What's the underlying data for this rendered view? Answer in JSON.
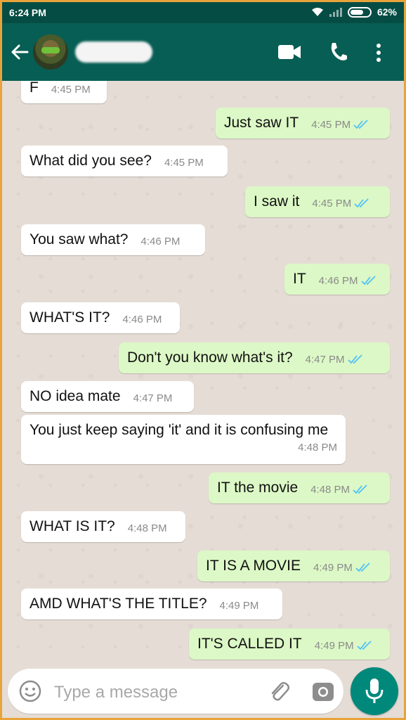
{
  "status_bar": {
    "time": "6:24 PM",
    "battery": "62%"
  },
  "header": {
    "back_icon": "arrow-left-icon",
    "actions": [
      "video-call-icon",
      "voice-call-icon",
      "more-vertical-icon"
    ]
  },
  "messages": [
    {
      "dir": "in",
      "text": "F",
      "time": "4:45 PM"
    },
    {
      "dir": "out",
      "text": "Just saw IT",
      "time": "4:45 PM",
      "read": true
    },
    {
      "dir": "in",
      "text": "What did you see?",
      "time": "4:45 PM"
    },
    {
      "dir": "out",
      "text": "I saw it",
      "time": "4:45 PM",
      "read": true
    },
    {
      "dir": "in",
      "text": "You saw what?",
      "time": "4:46 PM"
    },
    {
      "dir": "out",
      "text": "IT",
      "time": "4:46 PM",
      "read": true
    },
    {
      "dir": "in",
      "text": "WHAT'S IT?",
      "time": "4:46 PM"
    },
    {
      "dir": "out",
      "text": "Don't you know what's it?",
      "time": "4:47 PM",
      "read": true
    },
    {
      "dir": "in",
      "text": "NO idea mate",
      "time": "4:47 PM"
    },
    {
      "dir": "in",
      "text": "You just keep saying 'it' and it is confusing me",
      "time": "4:48 PM"
    },
    {
      "dir": "out",
      "text": "IT the movie",
      "time": "4:48 PM",
      "read": true
    },
    {
      "dir": "in",
      "text": "WHAT IS IT?",
      "time": "4:48 PM"
    },
    {
      "dir": "out",
      "text": "IT IS A MOVIE",
      "time": "4:49 PM",
      "read": true
    },
    {
      "dir": "in",
      "text": "AMD WHAT'S THE TITLE?",
      "time": "4:49 PM"
    },
    {
      "dir": "out",
      "text": "IT'S CALLED IT",
      "time": "4:49 PM",
      "read": true
    }
  ],
  "composer": {
    "placeholder": "Type a message",
    "icons": [
      "emoji-icon",
      "attach-icon",
      "camera-icon",
      "mic-icon"
    ]
  },
  "colors": {
    "header": "#075e54",
    "status_bar": "#054d44",
    "outgoing_bubble": "#dcf8c6",
    "incoming_bubble": "#ffffff",
    "read_ticks": "#4fc3f7",
    "mic_button": "#00897b"
  }
}
